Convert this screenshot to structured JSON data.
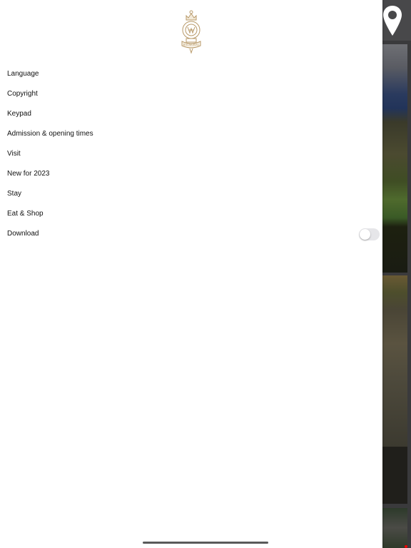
{
  "menu": {
    "items": [
      {
        "label": "Language"
      },
      {
        "label": "Copyright"
      },
      {
        "label": "Keypad"
      },
      {
        "label": "Admission & opening times"
      },
      {
        "label": "Visit"
      },
      {
        "label": "New for 2023"
      },
      {
        "label": "Stay"
      },
      {
        "label": "Eat & Shop"
      },
      {
        "label": "Download"
      }
    ],
    "download_toggle": {
      "on": false
    }
  },
  "logo": {
    "icon": "royal-crest-icon",
    "text": "BALMORAL",
    "color": "#b89a6a"
  },
  "background": {
    "icon": "map-pin-icon"
  }
}
